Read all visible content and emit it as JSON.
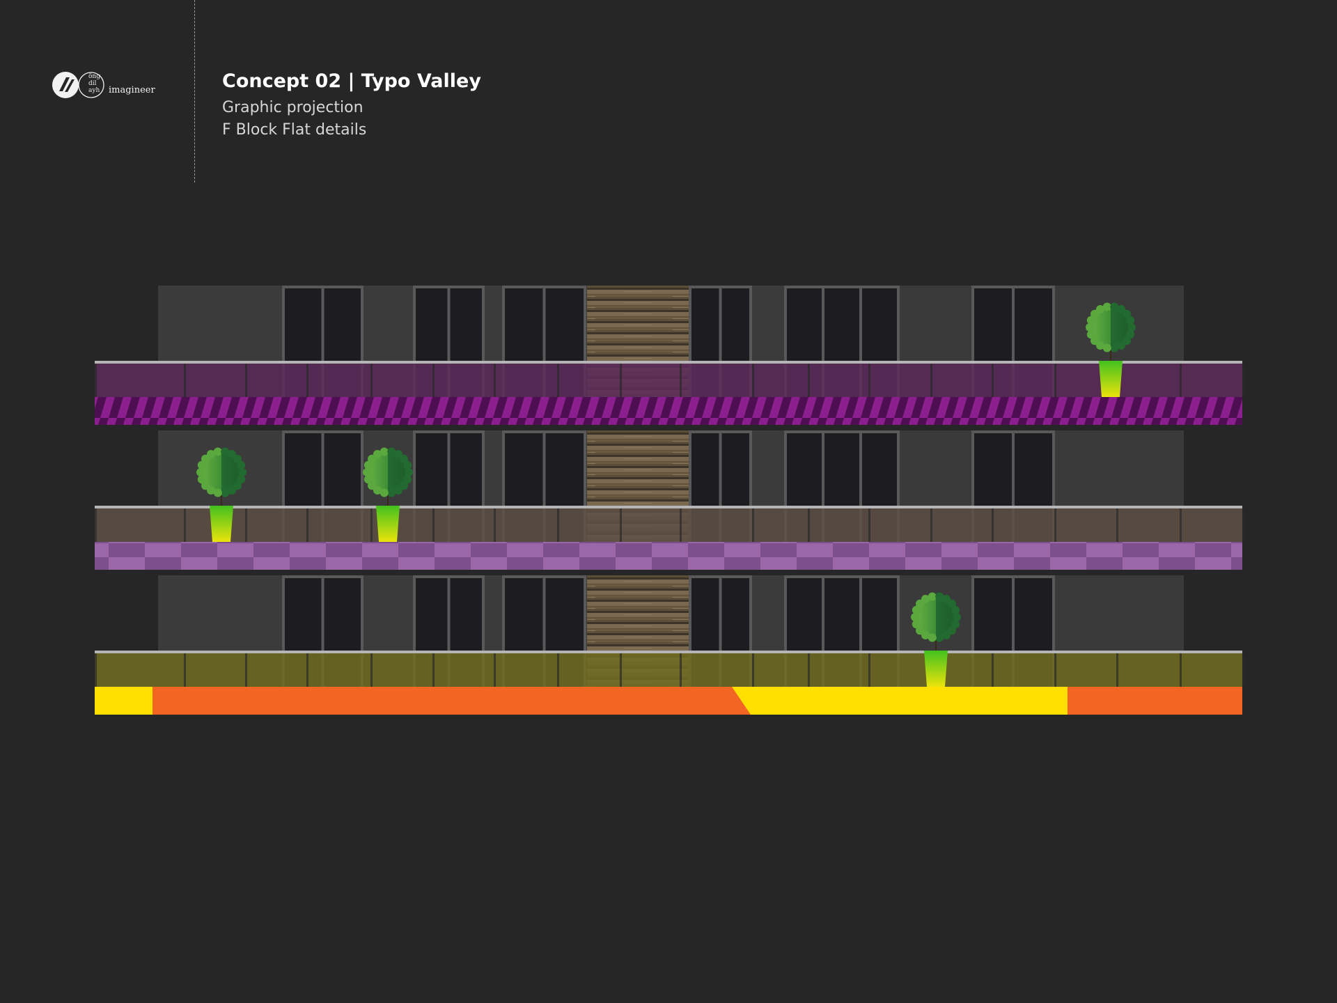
{
  "header": {
    "title": "Concept 02 | Typo Valley",
    "subtitle_1": "Graphic projection",
    "subtitle_2": "F Block Flat details"
  },
  "logo": {
    "name": "imagineer",
    "small_lines": [
      "öng",
      "dil",
      "ayh"
    ],
    "icon": "slash-mark-logo-icon"
  },
  "colors": {
    "background": "#262626",
    "wall": "#3b3b3b",
    "window_frame": "#595959",
    "glass": "#1d1c20",
    "wood": "#6b5a42",
    "railing": "#b5b5b5",
    "floor1_glass": "#5c2b5a",
    "floor1_band_a": "#8b1f8e",
    "floor1_band_b": "#4d0e52",
    "floor2_glass": "#5e5045",
    "floor2_check_a": "#9a67a8",
    "floor2_check_b": "#7d4f8d",
    "floor3_glass": "#6f6b22",
    "floor3_orange": "#f26522",
    "floor3_yellow": "#ffe000",
    "foliage_light": "#58a83c",
    "foliage_dark": "#246b2f",
    "pot_top": "#4bc51f",
    "pot_bottom": "#e5e60c"
  },
  "floors": [
    {
      "glass_color": "floor1_glass",
      "band_pattern": "diagonal-stripes",
      "plants": 1
    },
    {
      "glass_color": "floor2_glass",
      "band_pattern": "checkerboard",
      "plants": 2
    },
    {
      "glass_color": "floor3_glass",
      "band_pattern": "orange-yellow-blocks",
      "plants": 1
    }
  ]
}
